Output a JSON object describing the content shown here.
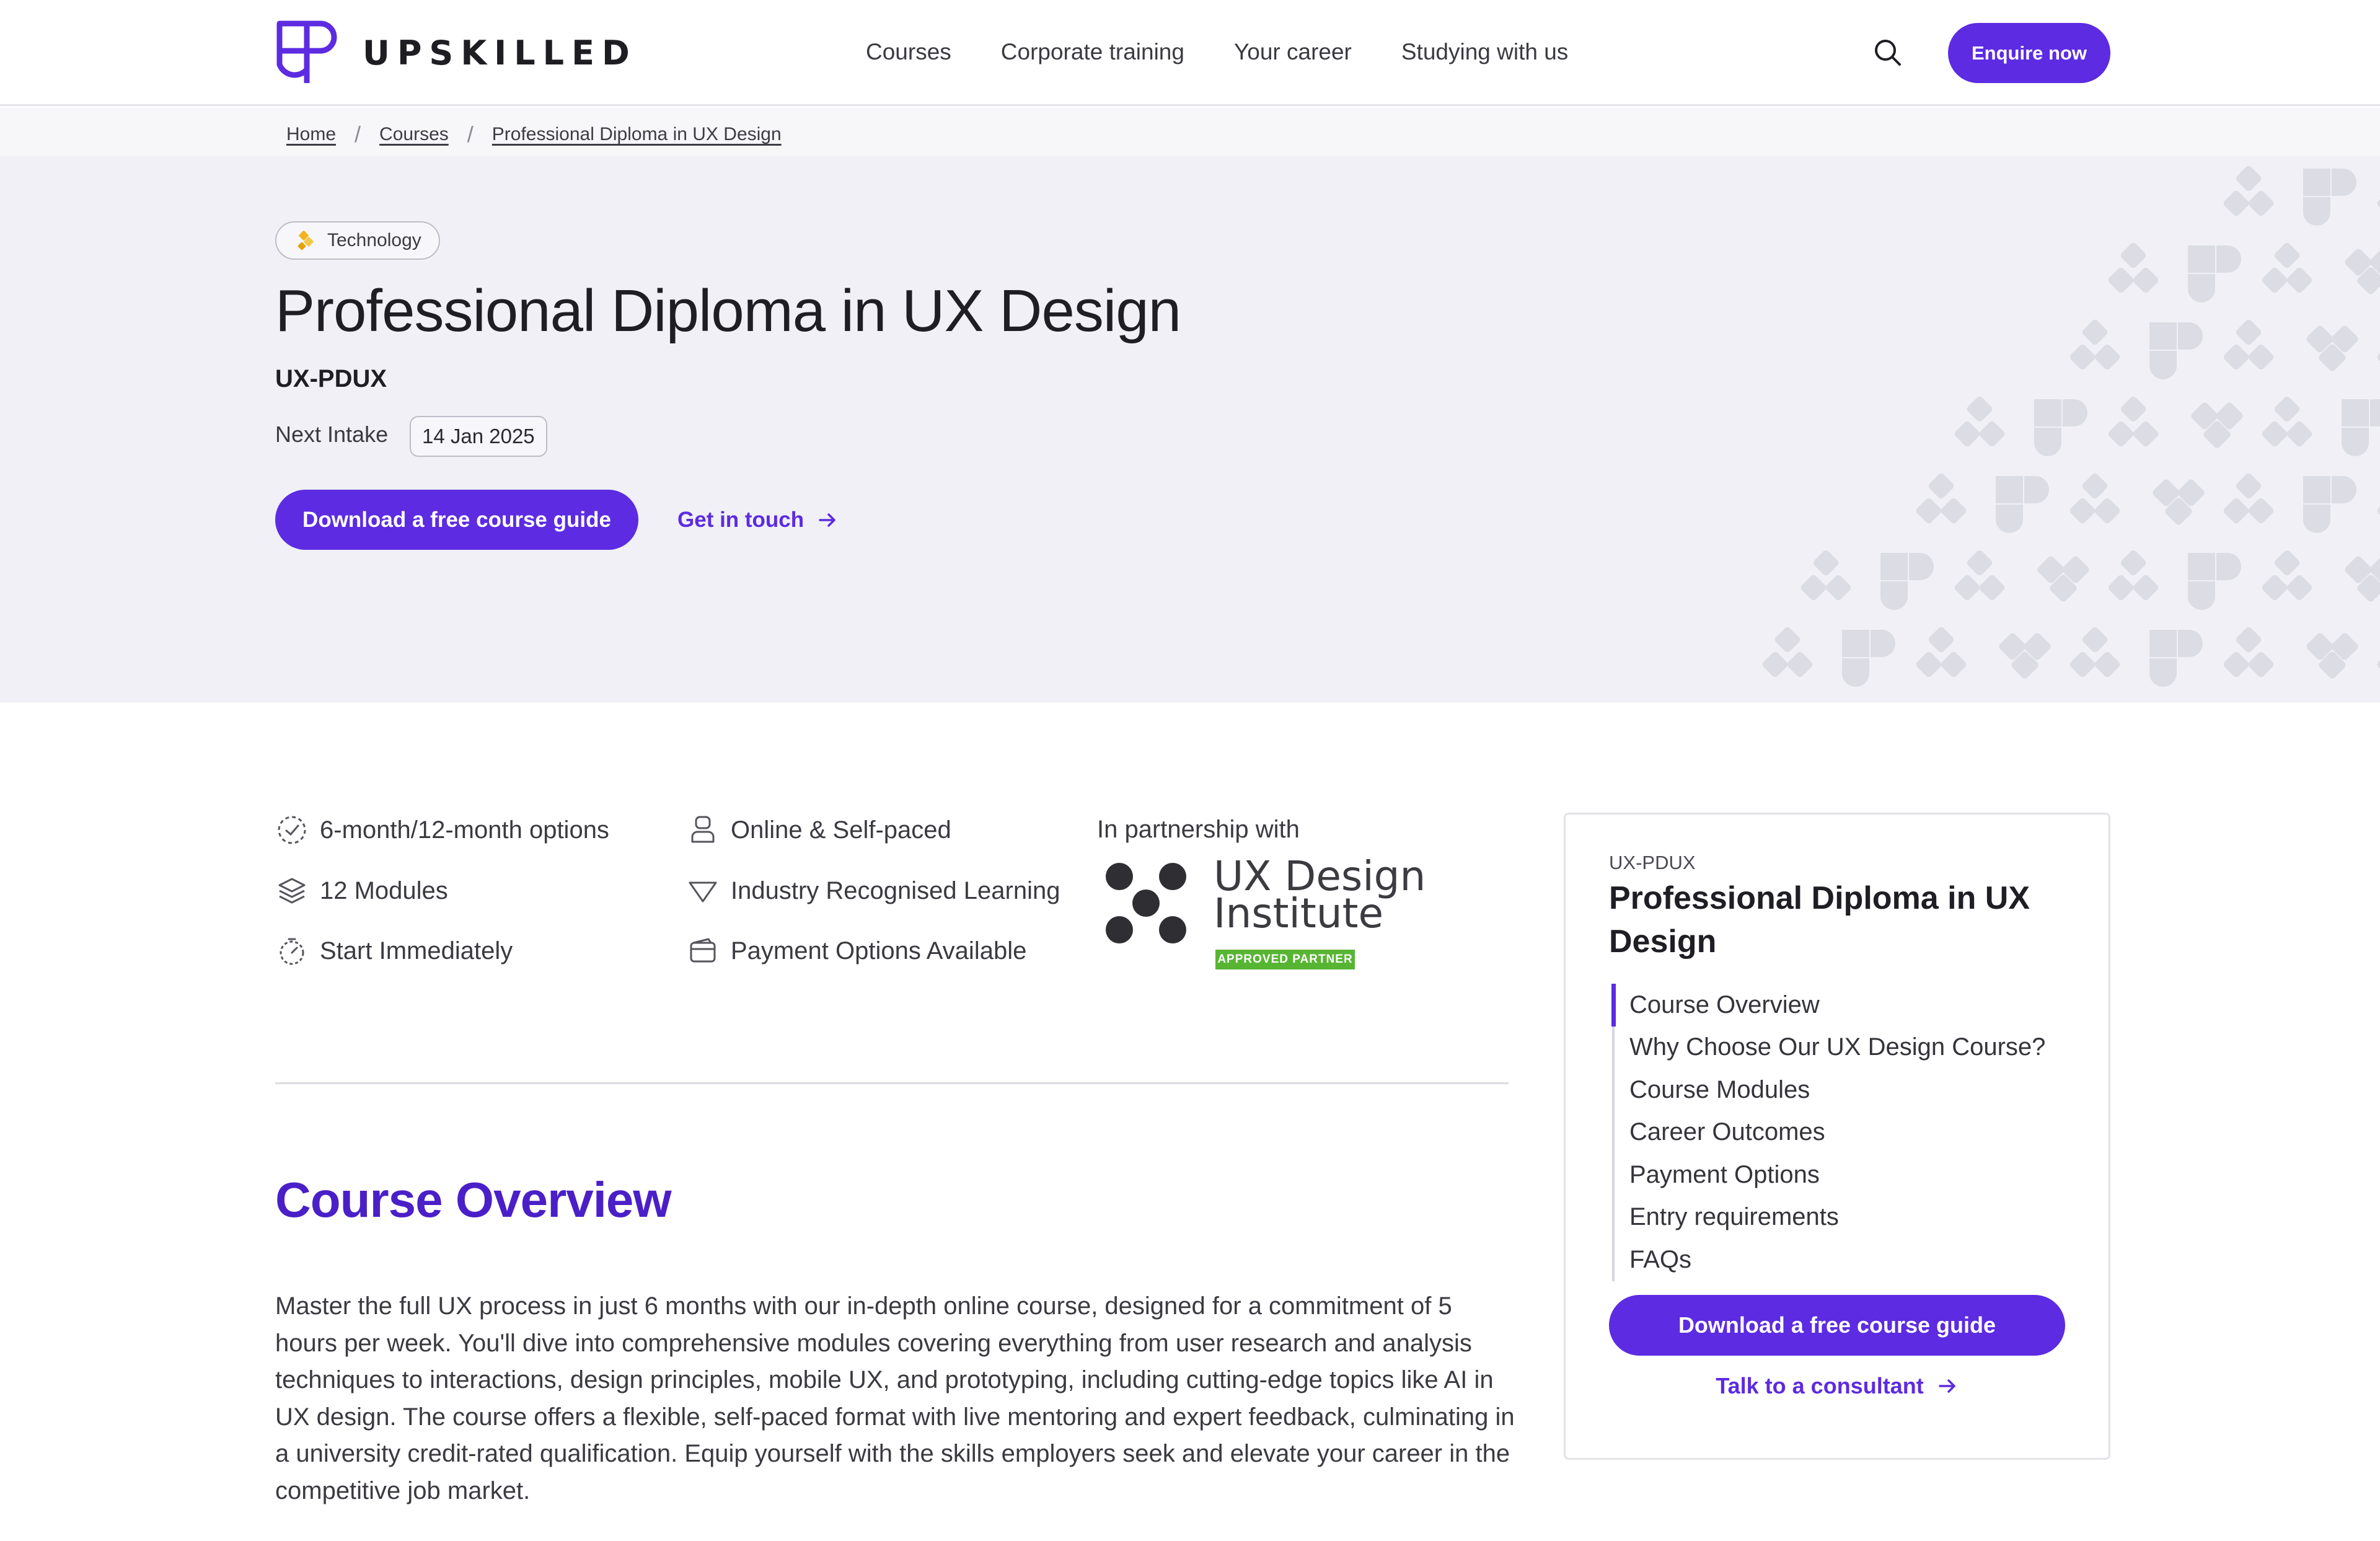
{
  "brand": {
    "name": "UPSKILLED",
    "accent": "#5c2be2",
    "heading_accent": "#4a1fc8"
  },
  "nav": {
    "items": [
      "Courses",
      "Corporate training",
      "Your career",
      "Studying with us"
    ],
    "enquire_label": "Enquire now",
    "search_icon": "search-icon"
  },
  "breadcrumb": [
    "Home",
    "Courses",
    "Professional Diploma in UX Design"
  ],
  "hero": {
    "tag": "Technology",
    "tag_icon": "technology-icon",
    "title": "Professional Diploma in UX Design",
    "code": "UX-PDUX",
    "intake_label": "Next Intake",
    "intake_date": "14 Jan 2025",
    "primary_cta": "Download a free course guide",
    "secondary_cta": "Get in touch"
  },
  "features": [
    {
      "label": "6-month/12-month options",
      "icon": "duration-icon"
    },
    {
      "label": "12 Modules",
      "icon": "layers-icon"
    },
    {
      "label": "Start Immediately",
      "icon": "timer-icon"
    },
    {
      "label": "Online & Self-paced",
      "icon": "online-learner-icon"
    },
    {
      "label": "Industry Recognised Learning",
      "icon": "shield-icon"
    },
    {
      "label": "Payment Options Available",
      "icon": "wallet-icon"
    }
  ],
  "partner": {
    "label": "In partnership with",
    "name_line1": "UX Design",
    "name_line2": "Institute",
    "badge": "APPROVED PARTNER",
    "badge_color": "#58b534"
  },
  "overview": {
    "title": "Course Overview",
    "body": "Master the full UX process in just 6 months with our in-depth online course, designed for a commitment of 5 hours per week. You'll dive into comprehensive modules covering everything from user research and analysis techniques to interactions, design principles, mobile UX, and prototyping, including cutting-edge topics like AI in UX design. The course offers a flexible, self-paced format with live mentoring and expert feedback, culminating in a university credit-rated qualification. Equip yourself with the skills employers seek and elevate your career in the competitive job market."
  },
  "sidebar": {
    "code": "UX-PDUX",
    "title": "Professional Diploma in UX Design",
    "toc": [
      "Course Overview",
      "Why Choose Our UX Design Course?",
      "Course Modules",
      "Career Outcomes",
      "Payment Options",
      "Entry requirements",
      "FAQs"
    ],
    "active_index": 0,
    "cta": "Download a free course guide",
    "link": "Talk to a consultant"
  }
}
